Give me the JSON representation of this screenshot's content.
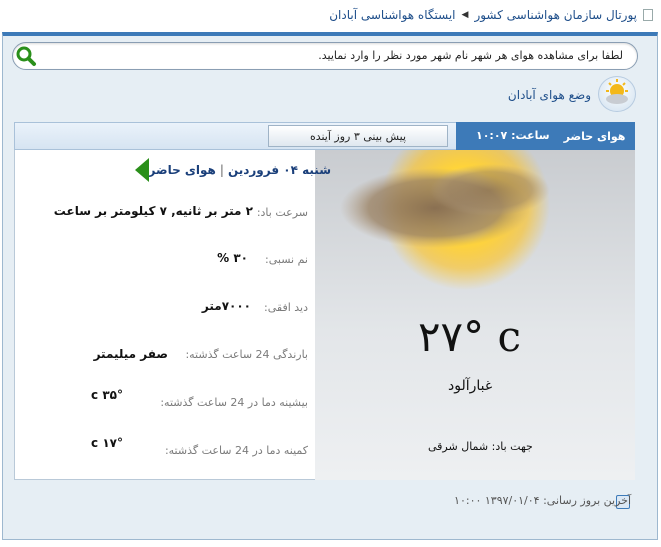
{
  "breadcrumb": {
    "portal": "پورتال سازمان هواشناسی کشور",
    "station": "ایستگاه هواشناسی آبادان"
  },
  "search": {
    "placeholder": "لطفا برای مشاهده هوای هر شهر نام شهر مورد نظر را وارد نمایید."
  },
  "location": {
    "title": "وضع هوای آبادان"
  },
  "tabs": {
    "current": "هوای حاضر",
    "time": "ساعت: ۱۰:۰۷",
    "forecast": "پیش بینی ۳ روز آینده"
  },
  "current": {
    "heading": "هوای حاضر",
    "date": "شنبه ۰۴ فروردین",
    "temperature": "۲۷° c",
    "condition": "غبارآلود",
    "wind_direction": "جهت باد: شمال شرقی"
  },
  "details": [
    {
      "label": "سرعت باد:",
      "value": "۲ متر بر ثانیه, ۷ کیلومتر بر ساعت"
    },
    {
      "label": "نم نسبی:",
      "value": "۳۰ %"
    },
    {
      "label": "دید افقی:",
      "value": "۷۰۰۰متر"
    },
    {
      "label": "بارندگی 24 ساعت گذشته:",
      "value": "صفر میلیمتر"
    },
    {
      "label": "بیشینه دما در 24 ساعت گذشته:",
      "value": "۳۵° c"
    },
    {
      "label": "کمینه دما در 24 ساعت گذشته:",
      "value": "۱۷° c"
    }
  ],
  "footer": {
    "last_update": "آخرین بروز رسانی: ۱۳۹۷/۰۱/۰۴ ۱۰:۰۰"
  }
}
